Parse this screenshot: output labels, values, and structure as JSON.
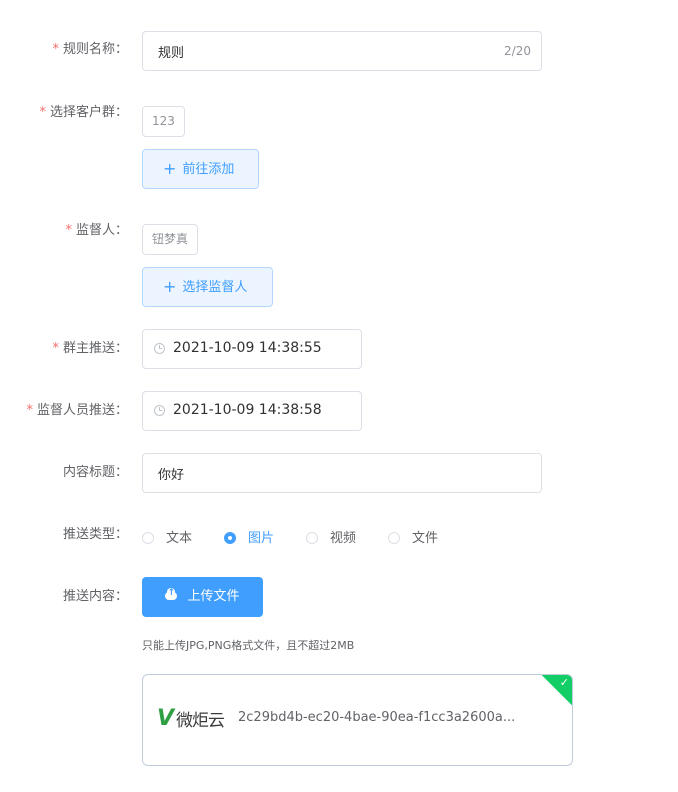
{
  "form": {
    "rule_name": {
      "label": "规则名称：",
      "value": "规则",
      "count": "2/20"
    },
    "customer_group": {
      "label": "选择客户群：",
      "tag": "123",
      "add_button": "前往添加"
    },
    "supervisor": {
      "label": "监督人：",
      "tag": "钮梦真",
      "select_button": "选择监督人"
    },
    "owner_push": {
      "label": "群主推送：",
      "value": "2021-10-09 14:38:55"
    },
    "supervisor_push": {
      "label": "监督人员推送：",
      "value": "2021-10-09 14:38:58"
    },
    "content_title": {
      "label": "内容标题：",
      "value": "你好"
    },
    "push_type": {
      "label": "推送类型：",
      "options": [
        "文本",
        "图片",
        "视频",
        "文件"
      ],
      "selected": "图片"
    },
    "push_content": {
      "label": "推送内容：",
      "upload_button": "上传文件",
      "tip": "只能上传JPG,PNG格式文件，且不超过2MB",
      "file": {
        "logo_text": "微炬云",
        "name": "2c29bd4b-ec20-4bae-90ea-f1cc3a2600a..."
      }
    }
  },
  "icons": {
    "plus": "plus-icon",
    "clock": "clock-icon",
    "upload": "cloud-upload-icon",
    "success": "check-icon"
  },
  "colors": {
    "primary": "#409eff",
    "required": "#f56c6c",
    "success": "#13ce66"
  }
}
